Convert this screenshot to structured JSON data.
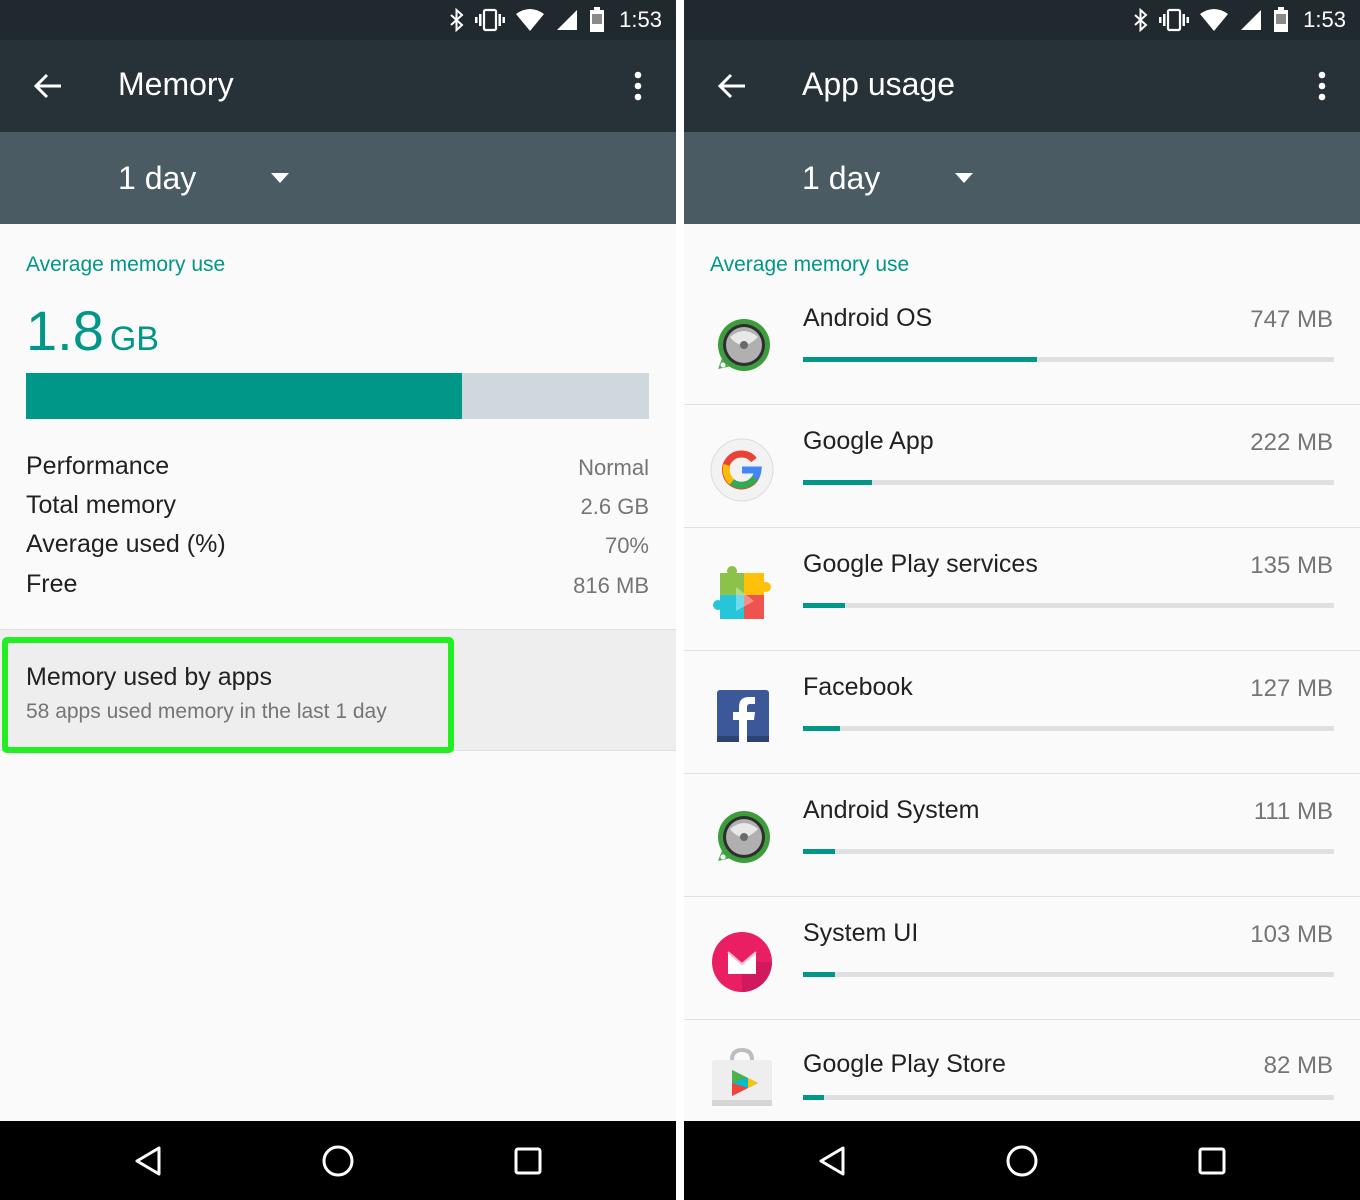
{
  "status_bar": {
    "time": "1:53",
    "icons": [
      "bluetooth-icon",
      "vibrate-icon",
      "wifi-icon",
      "signal-icon",
      "battery-icon"
    ]
  },
  "colors": {
    "accent": "#009688",
    "toolbar": "#263238",
    "subbar": "#4b5b63",
    "highlight": "#22ee22",
    "track": "#cfd8dc"
  },
  "memory_screen": {
    "title": "Memory",
    "period": "1 day",
    "section_header": "Average memory use",
    "average_value": "1.8",
    "average_unit": "GB",
    "usage_fraction": 0.7,
    "stats": [
      {
        "label": "Performance",
        "value": "Normal"
      },
      {
        "label": "Total memory",
        "value": "2.6 GB"
      },
      {
        "label": "Average used (%)",
        "value": "70%"
      },
      {
        "label": "Free",
        "value": "816 MB"
      }
    ],
    "apps_item": {
      "title": "Memory used by apps",
      "subtitle": "58 apps used memory in the last 1 day"
    }
  },
  "app_usage_screen": {
    "title": "App usage",
    "period": "1 day",
    "section_header": "Average memory use",
    "apps": [
      {
        "name": "Android OS",
        "size": "747 MB",
        "fraction": 0.44,
        "icon": "android-os-icon"
      },
      {
        "name": "Google App",
        "size": "222 MB",
        "fraction": 0.13,
        "icon": "google-app-icon"
      },
      {
        "name": "Google Play services",
        "size": "135 MB",
        "fraction": 0.08,
        "icon": "play-services-icon"
      },
      {
        "name": "Facebook",
        "size": "127 MB",
        "fraction": 0.07,
        "icon": "facebook-icon"
      },
      {
        "name": "Android System",
        "size": "111 MB",
        "fraction": 0.06,
        "icon": "android-system-icon"
      },
      {
        "name": "System UI",
        "size": "103 MB",
        "fraction": 0.06,
        "icon": "system-ui-icon"
      },
      {
        "name": "Google Play Store",
        "size": "82 MB",
        "fraction": 0.04,
        "icon": "play-store-icon"
      }
    ]
  }
}
